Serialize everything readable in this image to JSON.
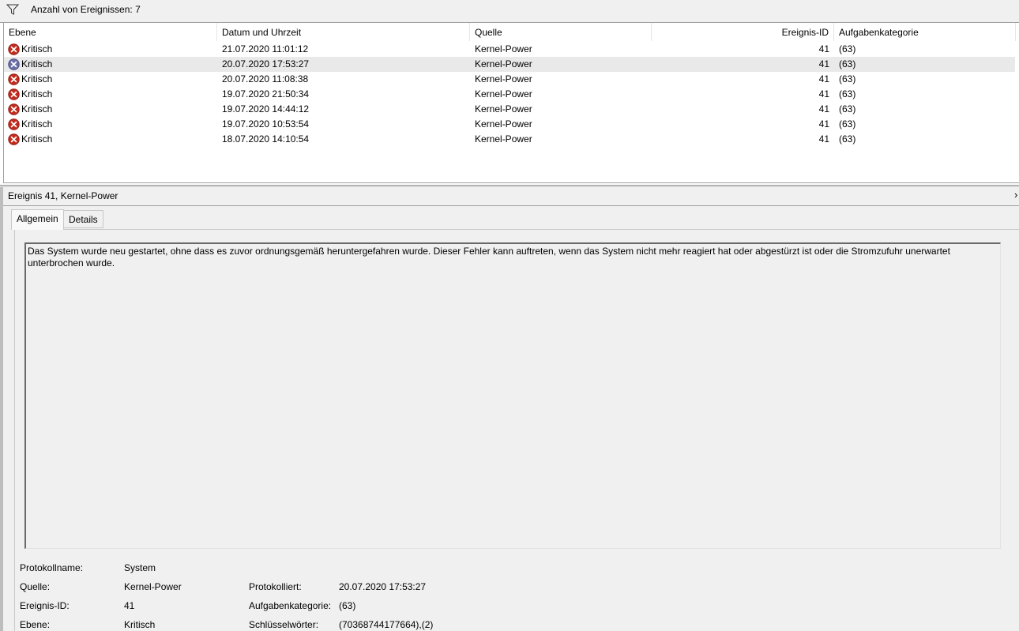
{
  "filter": {
    "icon": "funnel-icon",
    "count_label": "Anzahl von Ereignissen: 7"
  },
  "columns": [
    "Ebene",
    "Datum und Uhrzeit",
    "Quelle",
    "Ereignis-ID",
    "Aufgabenkategorie"
  ],
  "events": [
    {
      "level": "Kritisch",
      "datetime": "21.07.2020 11:01:12",
      "source": "Kernel-Power",
      "id": "41",
      "category": "(63)"
    },
    {
      "level": "Kritisch",
      "datetime": "20.07.2020 17:53:27",
      "source": "Kernel-Power",
      "id": "41",
      "category": "(63)",
      "selected": true
    },
    {
      "level": "Kritisch",
      "datetime": "20.07.2020 11:08:38",
      "source": "Kernel-Power",
      "id": "41",
      "category": "(63)"
    },
    {
      "level": "Kritisch",
      "datetime": "19.07.2020 21:50:34",
      "source": "Kernel-Power",
      "id": "41",
      "category": "(63)"
    },
    {
      "level": "Kritisch",
      "datetime": "19.07.2020 14:44:12",
      "source": "Kernel-Power",
      "id": "41",
      "category": "(63)"
    },
    {
      "level": "Kritisch",
      "datetime": "19.07.2020 10:53:54",
      "source": "Kernel-Power",
      "id": "41",
      "category": "(63)"
    },
    {
      "level": "Kritisch",
      "datetime": "18.07.2020 14:10:54",
      "source": "Kernel-Power",
      "id": "41",
      "category": "(63)"
    }
  ],
  "detail": {
    "title": "Ereignis 41, Kernel-Power",
    "collapse_glyph": "›",
    "tabs": [
      "Allgemein",
      "Details"
    ],
    "description": "Das System wurde neu gestartet, ohne dass es zuvor ordnungsgemäß heruntergefahren wurde. Dieser Fehler kann auftreten, wenn das System nicht mehr reagiert hat oder abgestürzt ist oder die Stromzufuhr unerwartet unterbrochen wurde.",
    "props": {
      "protokollname_label": "Protokollname:",
      "protokollname": "System",
      "quelle_label": "Quelle:",
      "quelle": "Kernel-Power",
      "protokolliert_label": "Protokolliert:",
      "protokolliert": "20.07.2020 17:53:27",
      "ereignis_id_label": "Ereignis-ID:",
      "ereignis_id": "41",
      "aufgabenkategorie_label": "Aufgabenkategorie:",
      "aufgabenkategorie": "(63)",
      "ebene_label": "Ebene:",
      "ebene": "Kritisch",
      "schluesselwoerter_label": "Schlüsselwörter:",
      "schluesselwoerter": "(70368744177664),(2)"
    }
  },
  "colors": {
    "error_red": "#c42b1c",
    "selected_row": "#e9e9e9",
    "pane_bg": "#f0f0f0"
  }
}
